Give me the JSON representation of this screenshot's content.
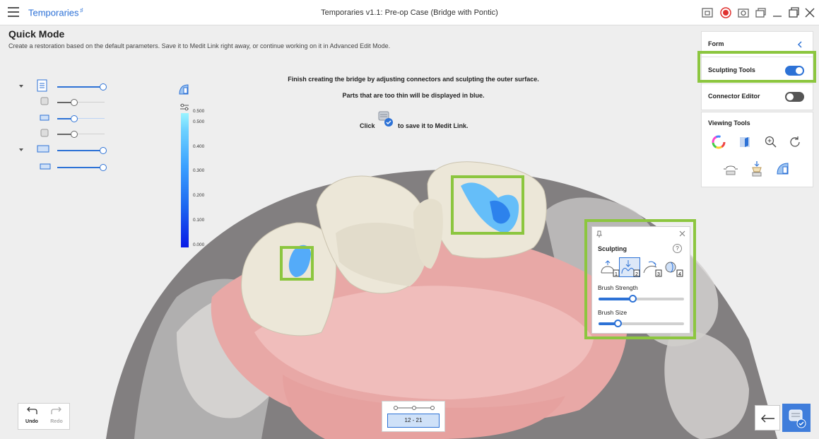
{
  "window": {
    "app_name": "Temporaries",
    "app_badge": "♯",
    "title": "Temporaries v1.1: Pre-op Case (Bridge with Pontic)"
  },
  "mode": {
    "title": "Quick Mode",
    "description": "Create a restoration based on the default parameters. Save it to Medit Link right away, or continue working on it in Advanced Edit Mode."
  },
  "instructions": {
    "line1": "Finish creating the bridge by adjusting connectors and sculpting the outer surface.",
    "line2": "Parts that are too thin will be displayed in blue.",
    "click": "Click",
    "save_suffix": "to save it to Medit Link."
  },
  "thickness_scale": {
    "label_top": "0.500",
    "labels": [
      "0.500",
      "0.400",
      "0.300",
      "0.200",
      "0.100",
      "0.000"
    ]
  },
  "right_panel": {
    "form_label": "Form",
    "sculpting_tools_label": "Sculpting Tools",
    "sculpting_tools_on": true,
    "connector_editor_label": "Connector Editor",
    "connector_editor_on": false,
    "viewing_tools_label": "Viewing Tools"
  },
  "sculpting_panel": {
    "title": "Sculpting",
    "help": "?",
    "tool_numbers": [
      "1",
      "2",
      "3",
      "4"
    ],
    "brush_strength_label": "Brush Strength",
    "brush_strength_value": 0.4,
    "brush_size_label": "Brush Size",
    "brush_size_value": 0.23
  },
  "bottom": {
    "undo_label": "Undo",
    "redo_label": "Redo",
    "stage_label": "12 - 21"
  },
  "colors": {
    "accent": "#2d72d6",
    "highlight_green": "#8cc63f",
    "thin_area_blue": "#3aa0ff",
    "gingiva": "#e8a8a6",
    "tooth": "#ece7d8",
    "record_red": "#e0312f"
  }
}
